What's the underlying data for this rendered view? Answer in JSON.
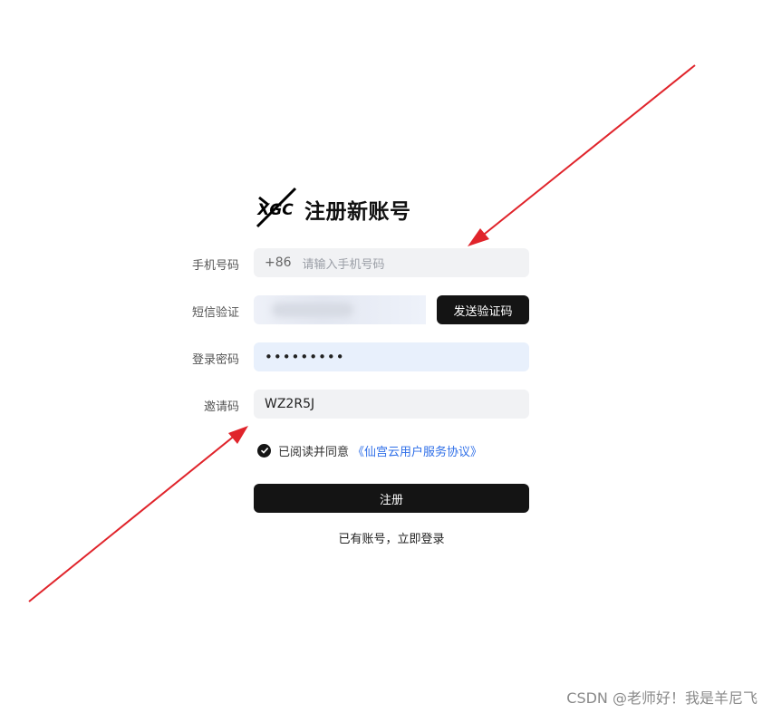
{
  "header": {
    "logo_text": "XGC",
    "title": "注册新账号"
  },
  "form": {
    "phone": {
      "label": "手机号码",
      "prefix": "+86",
      "placeholder": "请输入手机号码"
    },
    "sms": {
      "label": "短信验证",
      "button_label": "发送验证码"
    },
    "password": {
      "label": "登录密码",
      "value": "•••••••••"
    },
    "invite": {
      "label": "邀请码",
      "value": "WZ2R5J"
    },
    "agreement": {
      "text": "已阅读并同意",
      "link_text": "《仙宫云用户服务协议》",
      "checked": true
    },
    "submit_label": "注册",
    "login_text": "已有账号，立即登录"
  },
  "watermark": "CSDN @老师好！我是羊尼飞",
  "annotation": {
    "arrow_color": "#e0242b",
    "count": 2
  },
  "colors": {
    "primary": "#141414",
    "link": "#2f6fe8",
    "field_bg": "#f1f2f4",
    "focus_bg": "#e8f0fc"
  }
}
